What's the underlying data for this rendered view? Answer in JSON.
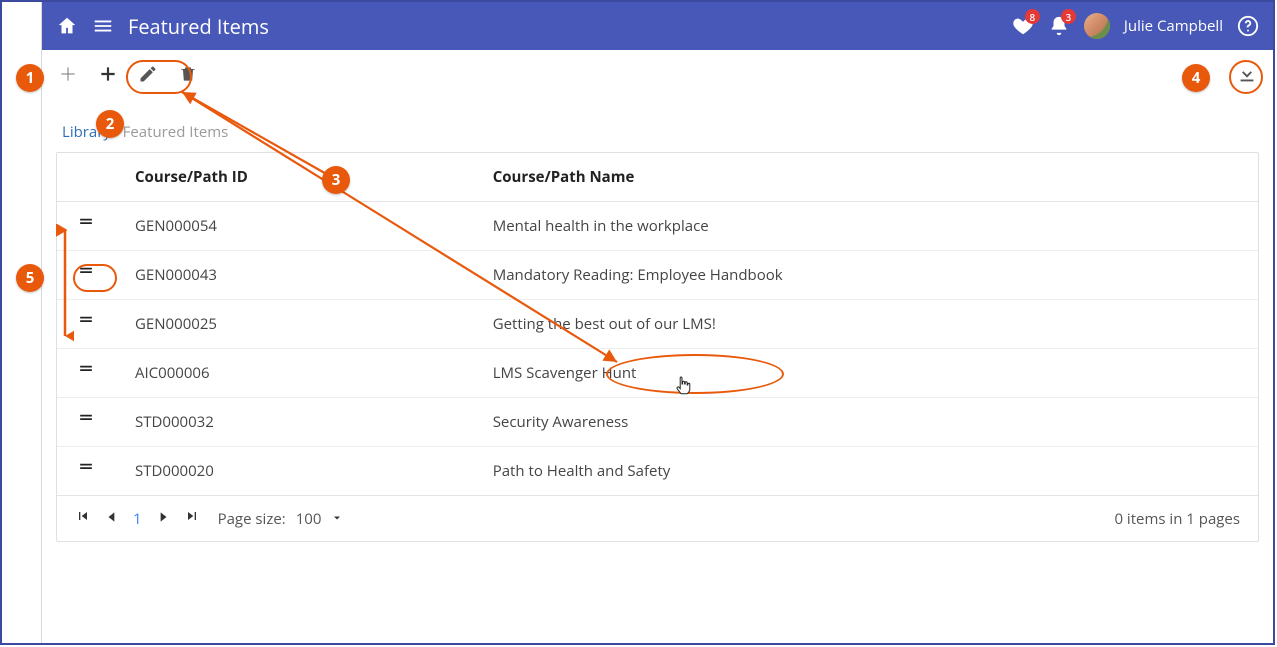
{
  "header": {
    "title": "Featured Items",
    "heart_badge": "8",
    "bell_badge": "3",
    "user_name": "Julie Campbell"
  },
  "breadcrumb": {
    "link_label": "Library",
    "current_label": "Featured Items"
  },
  "table": {
    "col_id": "Course/Path ID",
    "col_name": "Course/Path Name",
    "rows": [
      {
        "id": "GEN000054",
        "name": "Mental health in the workplace"
      },
      {
        "id": "GEN000043",
        "name": "Mandatory Reading: Employee Handbook"
      },
      {
        "id": "GEN000025",
        "name": "Getting the best out of our LMS!"
      },
      {
        "id": "AIC000006",
        "name": "LMS Scavenger Hunt"
      },
      {
        "id": "STD000032",
        "name": "Security Awareness"
      },
      {
        "id": "STD000020",
        "name": "Path to Health and Safety"
      }
    ]
  },
  "pager": {
    "page": "1",
    "page_size_label": "Page size:",
    "page_size_value": "100",
    "summary": "0 items in 1 pages"
  },
  "annotations": {
    "c1": "1",
    "c2": "2",
    "c3": "3",
    "c4": "4",
    "c5": "5"
  }
}
